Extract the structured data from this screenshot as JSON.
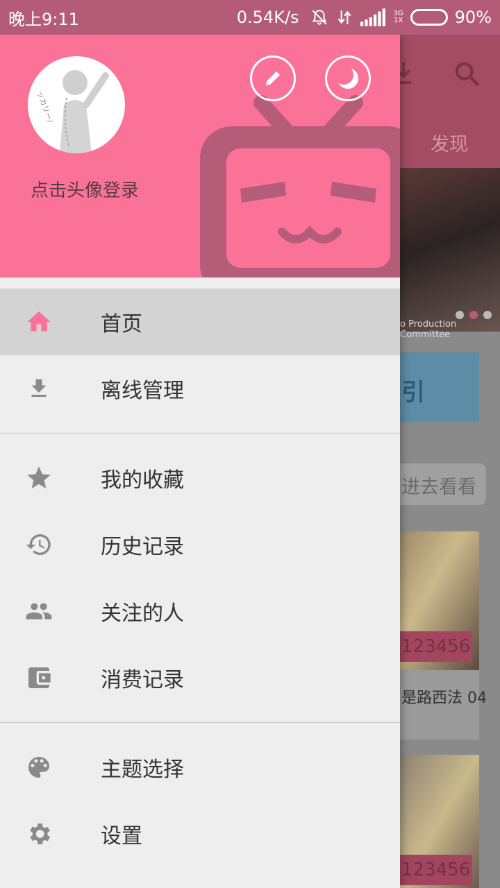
{
  "status_bar": {
    "time": "晚上9:11",
    "net_speed": "0.54K/s",
    "network_type_top": "3G",
    "network_type_bottom": "1X",
    "battery": "90%",
    "battery_level": 0.9
  },
  "background": {
    "tab_label": "发现",
    "banner_caption": "o Production Committee",
    "zigzag_label": "引",
    "button_label": "进去看看",
    "card_tag_1": "123456",
    "card_title": "是路西法 04",
    "card_tag_2": "123456"
  },
  "drawer": {
    "login_prompt": "点击头像登录",
    "avatar_scribble": "ッカリー/",
    "colors": {
      "accent": "#fb7299",
      "active_row": "#d3d3d3",
      "icon_gray": "#8a8a8a"
    },
    "menu_groups": [
      [
        {
          "label": "首页",
          "icon": "home-icon",
          "active": true
        },
        {
          "label": "离线管理",
          "icon": "download-icon",
          "active": false
        }
      ],
      [
        {
          "label": "我的收藏",
          "icon": "star-icon",
          "active": false
        },
        {
          "label": "历史记录",
          "icon": "history-icon",
          "active": false
        },
        {
          "label": "关注的人",
          "icon": "people-icon",
          "active": false
        },
        {
          "label": "消费记录",
          "icon": "wallet-icon",
          "active": false
        }
      ],
      [
        {
          "label": "主题选择",
          "icon": "palette-icon",
          "active": false
        },
        {
          "label": "设置",
          "icon": "settings-icon",
          "active": false
        }
      ]
    ]
  }
}
